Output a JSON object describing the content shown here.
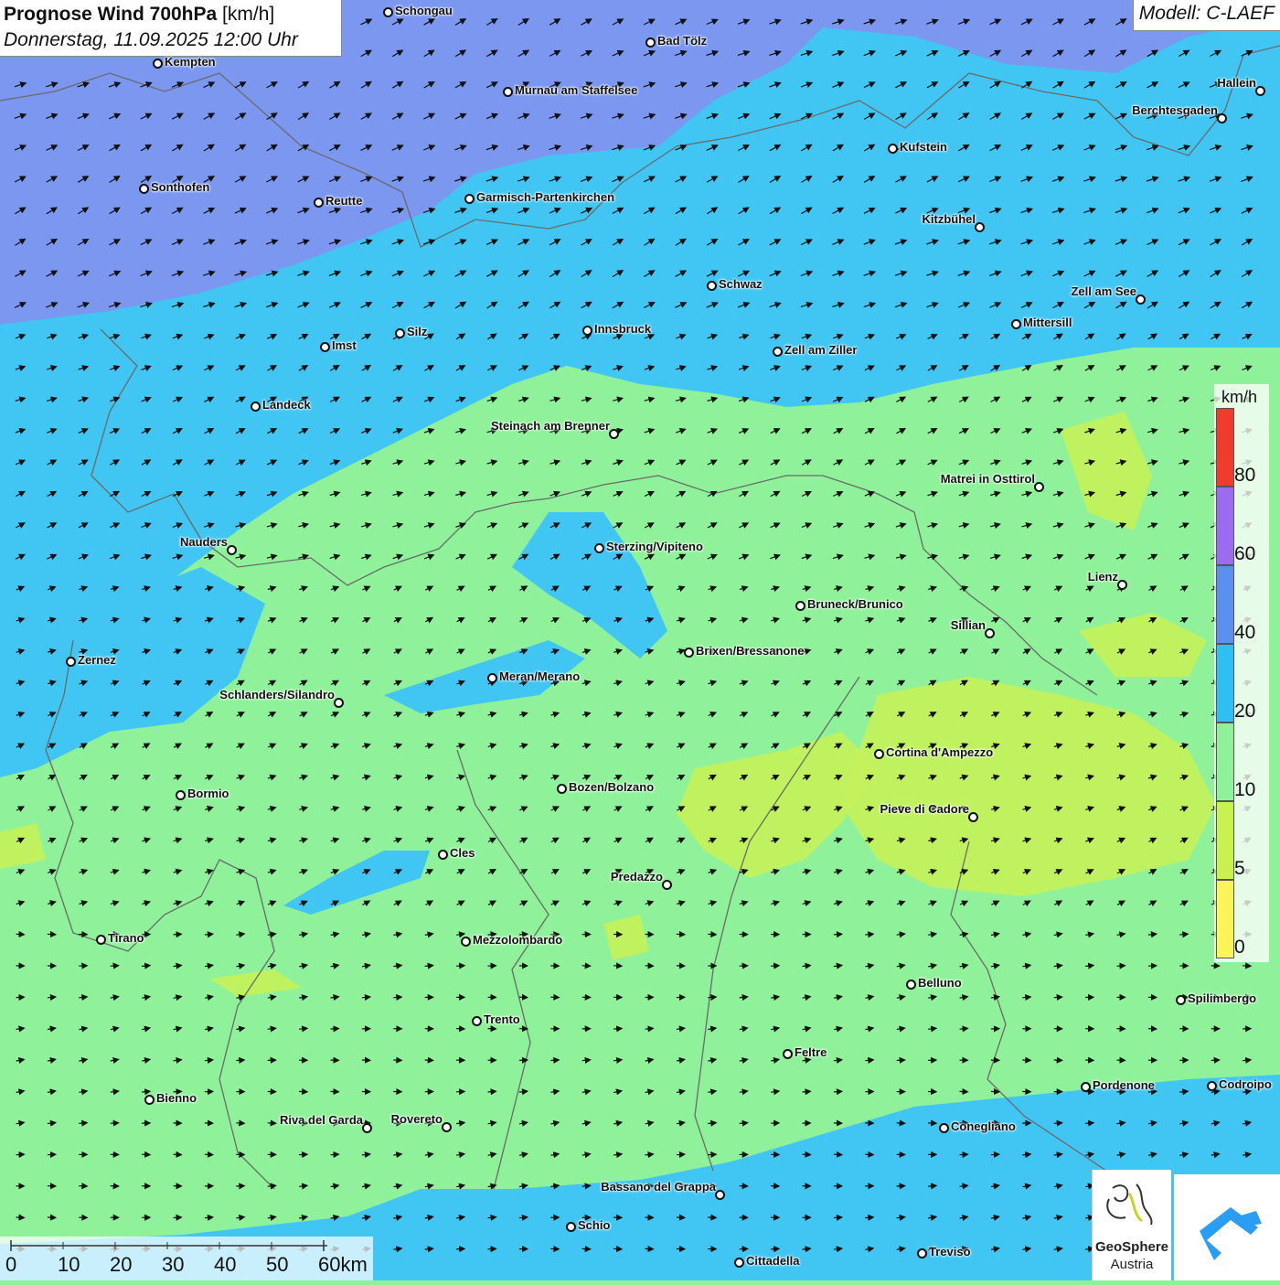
{
  "title": {
    "bold": "Prognose Wind 700hPa",
    "unit": "[km/h]",
    "datetime": "Donnerstag, 11.09.2025 12:00 Uhr"
  },
  "model": "Modell: C-LAEF",
  "legend": {
    "unit": "km/h",
    "ticks": [
      "80",
      "60",
      "40",
      "20",
      "10",
      "5",
      "0"
    ],
    "colors": [
      "#f03c2d",
      "#9b6cf0",
      "#5b8ff0",
      "#2ec0f2",
      "#8ff29a",
      "#c9f24f",
      "#fbf55a"
    ]
  },
  "scale": {
    "ticks": [
      "0",
      "10",
      "20",
      "30",
      "40",
      "50",
      "60km"
    ]
  },
  "logo": {
    "name": "GeoSphere",
    "country": "Austria"
  },
  "colors": {
    "strong_wind": "#7b97f0",
    "moderate_wind": "#41c6f3",
    "light_wind": "#8ff29a",
    "calm": "#c5f25a",
    "arrow": "#111111"
  },
  "cities": [
    {
      "id": "schongau",
      "name": "Schongau"
    },
    {
      "id": "bad-toelz",
      "name": "Bad Tölz"
    },
    {
      "id": "kempten",
      "name": "Kempten"
    },
    {
      "id": "murnau",
      "name": "Murnau am Staffelsee"
    },
    {
      "id": "hallein",
      "name": "Hallein"
    },
    {
      "id": "berchtesgaden",
      "name": "Berchtesgaden"
    },
    {
      "id": "kufstein",
      "name": "Kufstein"
    },
    {
      "id": "sonthofen",
      "name": "Sonthofen"
    },
    {
      "id": "reutte",
      "name": "Reutte"
    },
    {
      "id": "garmisch",
      "name": "Garmisch-Partenkirchen"
    },
    {
      "id": "kitzbuehel",
      "name": "Kitzbühel"
    },
    {
      "id": "schwaz",
      "name": "Schwaz"
    },
    {
      "id": "zell-am-see",
      "name": "Zell am See"
    },
    {
      "id": "mittersill",
      "name": "Mittersill"
    },
    {
      "id": "innsbruck",
      "name": "Innsbruck"
    },
    {
      "id": "imst",
      "name": "Imst"
    },
    {
      "id": "silz",
      "name": "Silz"
    },
    {
      "id": "zell-am-ziller",
      "name": "Zell am Ziller"
    },
    {
      "id": "landeck",
      "name": "Landeck"
    },
    {
      "id": "steinach",
      "name": "Steinach am Brenner"
    },
    {
      "id": "matrei",
      "name": "Matrei in Osttirol"
    },
    {
      "id": "nauders",
      "name": "Nauders"
    },
    {
      "id": "sterzing",
      "name": "Sterzing/Vipiteno"
    },
    {
      "id": "lienz",
      "name": "Lienz"
    },
    {
      "id": "bruneck",
      "name": "Bruneck/Brunico"
    },
    {
      "id": "sillian",
      "name": "Sillian"
    },
    {
      "id": "zernez",
      "name": "Zernez"
    },
    {
      "id": "brixen",
      "name": "Brixen/Bressanone"
    },
    {
      "id": "meran",
      "name": "Meran/Merano"
    },
    {
      "id": "schlanders",
      "name": "Schlanders/Silandro"
    },
    {
      "id": "cortina",
      "name": "Cortina d'Ampezzo"
    },
    {
      "id": "bozen",
      "name": "Bozen/Bolzano"
    },
    {
      "id": "bormio",
      "name": "Bormio"
    },
    {
      "id": "pieve",
      "name": "Pieve di Cadore"
    },
    {
      "id": "cles",
      "name": "Cles"
    },
    {
      "id": "predazzo",
      "name": "Predazzo"
    },
    {
      "id": "tirano",
      "name": "Tirano"
    },
    {
      "id": "mezzolombardo",
      "name": "Mezzolombardo"
    },
    {
      "id": "belluno",
      "name": "Belluno"
    },
    {
      "id": "spilimbergo",
      "name": "Spilimbergo"
    },
    {
      "id": "trento",
      "name": "Trento"
    },
    {
      "id": "feltre",
      "name": "Feltre"
    },
    {
      "id": "pordenone",
      "name": "Pordenone"
    },
    {
      "id": "codroipo",
      "name": "Codroipo"
    },
    {
      "id": "bienno",
      "name": "Bienno"
    },
    {
      "id": "riva",
      "name": "Riva del Garda"
    },
    {
      "id": "rovereto",
      "name": "Rovereto"
    },
    {
      "id": "conegliano",
      "name": "Conegliano"
    },
    {
      "id": "bassano",
      "name": "Bassano del Grappa"
    },
    {
      "id": "schio",
      "name": "Schio"
    },
    {
      "id": "treviso",
      "name": "Treviso"
    },
    {
      "id": "cittadella",
      "name": "Cittadella"
    }
  ]
}
